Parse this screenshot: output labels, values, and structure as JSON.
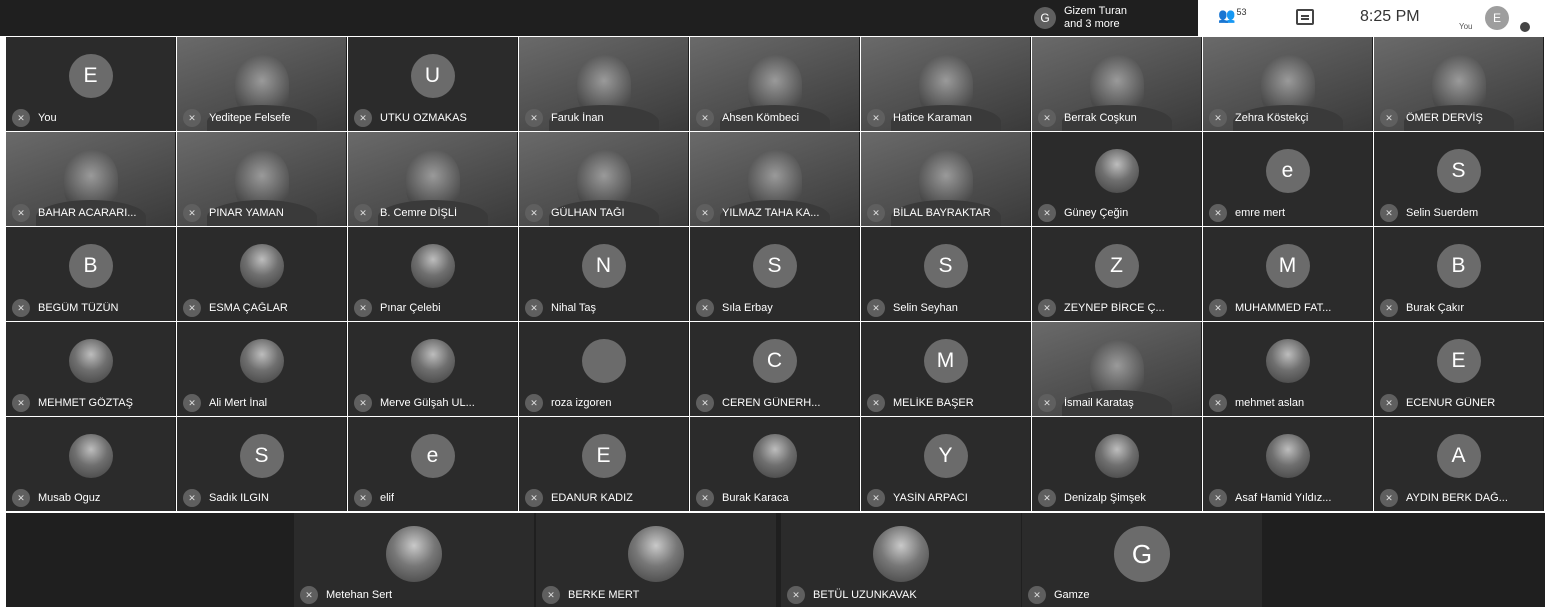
{
  "topbar": {
    "presenter_initial": "G",
    "presenter_line1": "Gizem Turan",
    "presenter_line2": "and 3 more",
    "people_count": "53",
    "clock": "8:25 PM",
    "you_label": "You",
    "self_initial": "E"
  },
  "rows": [
    [
      {
        "name": "You",
        "initial": "E",
        "kind": "letter"
      },
      {
        "name": "Yeditepe Felsefe",
        "kind": "video"
      },
      {
        "name": "UTKU OZMAKAS",
        "initial": "U",
        "kind": "letter"
      },
      {
        "name": "Faruk İnan",
        "kind": "video"
      },
      {
        "name": "Ahsen Kömbeci",
        "kind": "video"
      },
      {
        "name": "Hatice Karaman",
        "kind": "video"
      },
      {
        "name": "Berrak Coşkun",
        "kind": "video"
      },
      {
        "name": "Zehra Köstekçi",
        "kind": "video"
      },
      {
        "name": "ÖMER DERVİŞ",
        "kind": "video"
      }
    ],
    [
      {
        "name": "BAHAR ACARARI...",
        "kind": "video"
      },
      {
        "name": "PINAR YAMAN",
        "kind": "video"
      },
      {
        "name": "B. Cemre DİŞLİ",
        "kind": "video"
      },
      {
        "name": "GÜLHAN TAĞI",
        "kind": "video"
      },
      {
        "name": "YILMAZ TAHA KA...",
        "kind": "video"
      },
      {
        "name": "BİLAL BAYRAKTAR",
        "kind": "video"
      },
      {
        "name": "Güney Çeğin",
        "kind": "photo"
      },
      {
        "name": "emre mert",
        "initial": "e",
        "kind": "letter"
      },
      {
        "name": "Selin Suerdem",
        "initial": "S",
        "kind": "letter"
      }
    ],
    [
      {
        "name": "BEGÜM TÜZÜN",
        "initial": "B",
        "kind": "letter"
      },
      {
        "name": "ESMA ÇAĞLAR",
        "kind": "photo"
      },
      {
        "name": "Pınar Çelebi",
        "kind": "photo"
      },
      {
        "name": "Nihal Taş",
        "initial": "N",
        "kind": "letter"
      },
      {
        "name": "Sıla Erbay",
        "initial": "S",
        "kind": "letter"
      },
      {
        "name": "Selin Seyhan",
        "initial": "S",
        "kind": "letter"
      },
      {
        "name": "ZEYNEP BİRCE Ç...",
        "initial": "Z",
        "kind": "letter"
      },
      {
        "name": "MUHAMMED FAT...",
        "initial": "M",
        "kind": "letter"
      },
      {
        "name": "Burak Çakır",
        "initial": "B",
        "kind": "letter"
      }
    ],
    [
      {
        "name": "MEHMET GÖZTAŞ",
        "kind": "photo"
      },
      {
        "name": "Ali Mert İnal",
        "kind": "photo"
      },
      {
        "name": "Merve Gülşah UL...",
        "kind": "photo"
      },
      {
        "name": "roza izgoren",
        "initial": "",
        "kind": "letter"
      },
      {
        "name": "CEREN GÜNERH...",
        "initial": "C",
        "kind": "letter"
      },
      {
        "name": "MELİKE BAŞER",
        "initial": "M",
        "kind": "letter"
      },
      {
        "name": "İsmail Karataş",
        "kind": "video"
      },
      {
        "name": "mehmet aslan",
        "kind": "photo"
      },
      {
        "name": "ECENUR GÜNER",
        "initial": "E",
        "kind": "letter"
      }
    ],
    [
      {
        "name": "Musab Oguz",
        "kind": "photo"
      },
      {
        "name": "Sadık ILGIN",
        "initial": "S",
        "kind": "letter"
      },
      {
        "name": "elif",
        "initial": "e",
        "kind": "letter"
      },
      {
        "name": "EDANUR KADIZ",
        "initial": "E",
        "kind": "letter"
      },
      {
        "name": "Burak Karaca",
        "kind": "photo"
      },
      {
        "name": "YASİN ARPACI",
        "initial": "Y",
        "kind": "letter"
      },
      {
        "name": "Denizalp Şimşek",
        "kind": "photo"
      },
      {
        "name": "Asaf Hamid Yıldız...",
        "kind": "photo"
      },
      {
        "name": "AYDIN BERK DAĞ...",
        "initial": "A",
        "kind": "letter"
      }
    ]
  ],
  "bottom": [
    {
      "name": "Metehan Sert",
      "kind": "photo"
    },
    {
      "name": "BERKE MERT",
      "kind": "photo"
    },
    {
      "name": "BETÜL UZUNKAVAK",
      "kind": "photo"
    },
    {
      "name": "Gamze",
      "initial": "G",
      "kind": "letter"
    }
  ]
}
